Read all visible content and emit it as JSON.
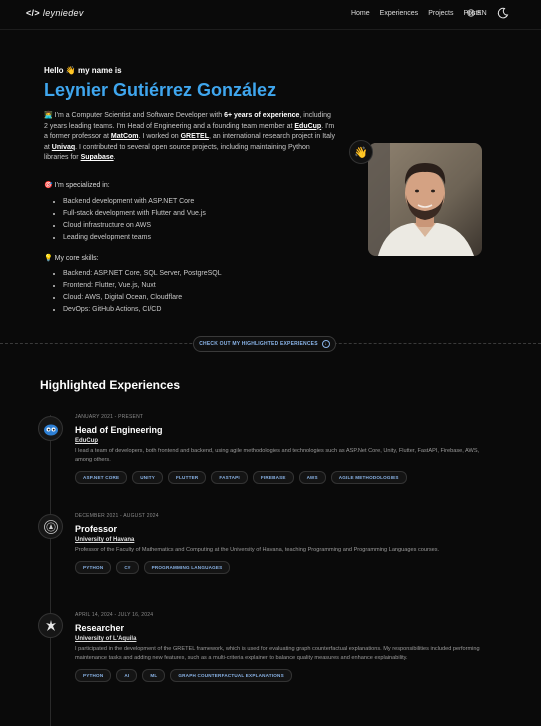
{
  "nav": {
    "logo_text": "leyniedev",
    "links": [
      "Home",
      "Experiences",
      "Projects",
      "Posts"
    ],
    "lang": "EN"
  },
  "hero": {
    "hello": "Hello 👋 my name is",
    "name": "Leynier Gutiérrez González",
    "bio": {
      "p1": "👨‍💻 I'm a Computer Scientist and Software Developer with ",
      "p1_bold": "6+ years of experience",
      "p2": ", including 2 years leading teams. I'm Head of Engineering and a founding team member at ",
      "educup": "EduCup",
      "p3": ". I'm a former professor at ",
      "matcom": "MatCom",
      "p4": ". I worked on ",
      "gretel": "GRETEL",
      "p5": ", an international research project in Italy at ",
      "univaq": "Univaq",
      "p6": ". I contributed to several open source projects, including maintaining Python libraries for ",
      "supabase": "Supabase",
      "p7": "."
    },
    "specialized_title": "🎯 I'm specialized in:",
    "specialized": [
      "Backend development with ASP.NET Core",
      "Full-stack development with Flutter and Vue.js",
      "Cloud infrastructure on AWS",
      "Leading development teams"
    ],
    "skills_title": "💡 My core skills:",
    "skills": [
      "Backend: ASP.NET Core, SQL Server, PostgreSQL",
      "Frontend: Flutter, Vue.js, Nuxt",
      "Cloud: AWS, Digital Ocean, Cloudflare",
      "DevOps: GitHub Actions, CI/CD"
    ],
    "wave": "👋"
  },
  "cta": {
    "label": "CHECK OUT MY HIGHLIGHTED EXPERIENCES"
  },
  "experiences_title": "Highlighted Experiences",
  "experiences": [
    {
      "date": "JANUARY 2021 - PRESENT",
      "role": "Head of Engineering",
      "org": "EduCup",
      "desc": "I lead a team of developers, both frontend and backend, using agile methodologies and technologies such as ASP.Net Core, Unity, Flutter, FastAPI, Firebase, AWS, among others.",
      "tags": [
        "ASP.NET CORE",
        "UNITY",
        "FLUTTER",
        "FASTAPI",
        "FIREBASE",
        "AWS",
        "AGILE METHODOLOGIES"
      ]
    },
    {
      "date": "DECEMBER 2021 - AUGUST 2024",
      "role": "Professor",
      "org": "University of Havana",
      "desc": "Professor of the Faculty of Mathematics and Computing at the University of Havana, teaching Programming and Programming Languages courses.",
      "tags": [
        "PYTHON",
        "C#",
        "PROGRAMMING LANGUAGES"
      ]
    },
    {
      "date": "APRIL 14, 2024 - JULY 16, 2024",
      "role": "Researcher",
      "org": "University of L'Aquila",
      "desc": "I participated in the development of the GRETEL framework, which is used for evaluating graph counterfactual explanations. My responsibilities included performing maintenance tasks and adding new features, such as a multi-criteria explainer to balance quality measures and enhance explainability.",
      "tags": [
        "PYTHON",
        "AI",
        "ML",
        "GRAPH COUNTERFACTUAL EXPLANATIONS"
      ]
    }
  ]
}
